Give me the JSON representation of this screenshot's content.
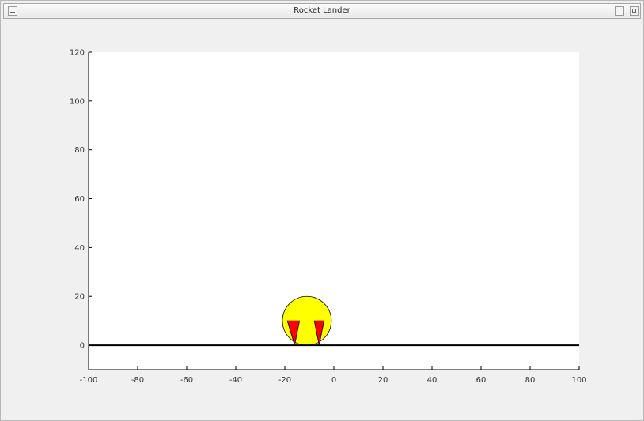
{
  "window": {
    "title": "Rocket Lander"
  },
  "chart_data": {
    "type": "scatter",
    "title": "",
    "xlabel": "",
    "ylabel": "",
    "xlim": [
      -100,
      100
    ],
    "ylim": [
      -10,
      120
    ],
    "xticks": [
      -100,
      -80,
      -60,
      -40,
      -20,
      0,
      20,
      40,
      60,
      80,
      100
    ],
    "yticks": [
      0,
      20,
      40,
      60,
      80,
      100,
      120
    ],
    "ground": {
      "y": 0,
      "x_from": -100,
      "x_to": 100,
      "color": "#000000"
    },
    "rocket": {
      "body_center": [
        -11,
        10
      ],
      "body_radius": 10,
      "body_color": "#ffff00",
      "thruster_color": "#ff0000",
      "thrusters": [
        {
          "top_left": [
            -19,
            10
          ],
          "top_right": [
            -14,
            10
          ],
          "bottom": [
            -16,
            0
          ]
        },
        {
          "top_left": [
            -8,
            10
          ],
          "top_right": [
            -4,
            10
          ],
          "bottom": [
            -6,
            0
          ]
        }
      ]
    }
  },
  "colors": {
    "axes_background": "#ffffff",
    "figure_background": "#f0f0f0"
  }
}
